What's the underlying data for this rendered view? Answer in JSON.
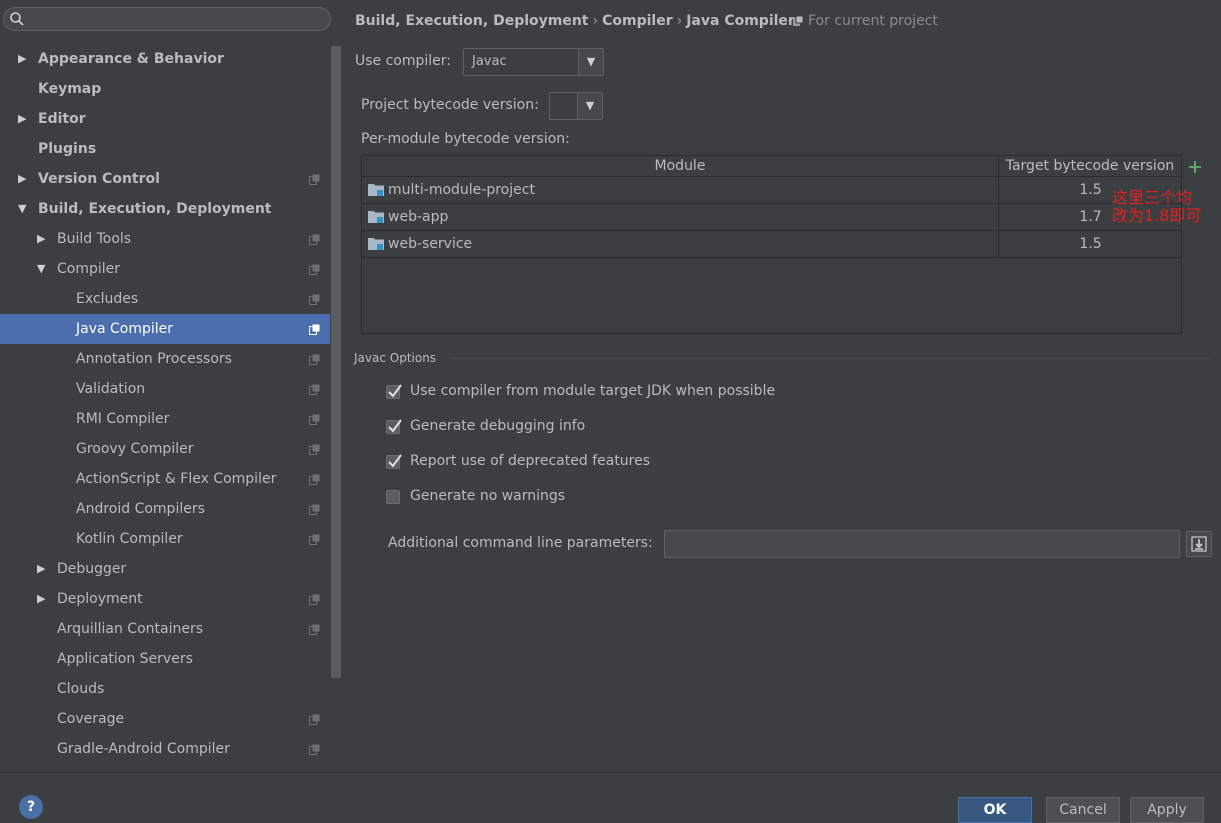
{
  "sidebar": {
    "items": [
      {
        "label": "Appearance & Behavior",
        "arrow": "▶"
      },
      {
        "label": "Keymap",
        "arrow": ""
      },
      {
        "label": "Editor",
        "arrow": "▶"
      },
      {
        "label": "Plugins",
        "arrow": ""
      },
      {
        "label": "Version Control",
        "arrow": "▶"
      },
      {
        "label": "Build, Execution, Deployment",
        "arrow": "▼"
      },
      {
        "label": "Build Tools",
        "arrow": "▶"
      },
      {
        "label": "Compiler",
        "arrow": "▼"
      },
      {
        "label": "Excludes",
        "arrow": ""
      },
      {
        "label": "Java Compiler",
        "arrow": ""
      },
      {
        "label": "Annotation Processors",
        "arrow": ""
      },
      {
        "label": "Validation",
        "arrow": ""
      },
      {
        "label": "RMI Compiler",
        "arrow": ""
      },
      {
        "label": "Groovy Compiler",
        "arrow": ""
      },
      {
        "label": "ActionScript & Flex Compiler",
        "arrow": ""
      },
      {
        "label": "Android Compilers",
        "arrow": ""
      },
      {
        "label": "Kotlin Compiler",
        "arrow": ""
      },
      {
        "label": "Debugger",
        "arrow": "▶"
      },
      {
        "label": "Deployment",
        "arrow": "▶"
      },
      {
        "label": "Arquillian Containers",
        "arrow": ""
      },
      {
        "label": "Application Servers",
        "arrow": ""
      },
      {
        "label": "Clouds",
        "arrow": ""
      },
      {
        "label": "Coverage",
        "arrow": ""
      },
      {
        "label": "Gradle-Android Compiler",
        "arrow": ""
      }
    ]
  },
  "breadcrumb": {
    "part1": "Build, Execution, Deployment",
    "part2": "Compiler",
    "part3": "Java Compiler",
    "sep": "›",
    "scope": "For current project"
  },
  "compiler": {
    "use_compiler_label": "Use compiler:",
    "use_compiler_value": "Javac",
    "project_bytecode_label": "Project bytecode version:",
    "project_bytecode_value": "",
    "per_module_label": "Per-module bytecode version:"
  },
  "table": {
    "col_module": "Module",
    "col_target": "Target bytecode version",
    "rows": [
      {
        "module": "multi-module-project",
        "version": "1.5"
      },
      {
        "module": "web-app",
        "version": "1.7"
      },
      {
        "module": "web-service",
        "version": "1.5"
      }
    ]
  },
  "annotation": {
    "line1": "这里三个均",
    "line2": "改为1.8即可"
  },
  "javac_options": {
    "title": "Javac Options",
    "options": [
      {
        "label": "Use compiler from module target JDK when possible",
        "checked": true
      },
      {
        "label": "Generate debugging info",
        "checked": true
      },
      {
        "label": "Report use of deprecated features",
        "checked": true
      },
      {
        "label": "Generate no warnings",
        "checked": false
      }
    ],
    "additional_label": "Additional command line parameters:",
    "additional_value": ""
  },
  "footer": {
    "help": "?",
    "ok": "OK",
    "cancel": "Cancel",
    "apply": "Apply"
  },
  "colors": {
    "background": "#3c3f41",
    "selection": "#4b6eaf",
    "annotation": "#e02020",
    "add_icon": "#59a869"
  }
}
